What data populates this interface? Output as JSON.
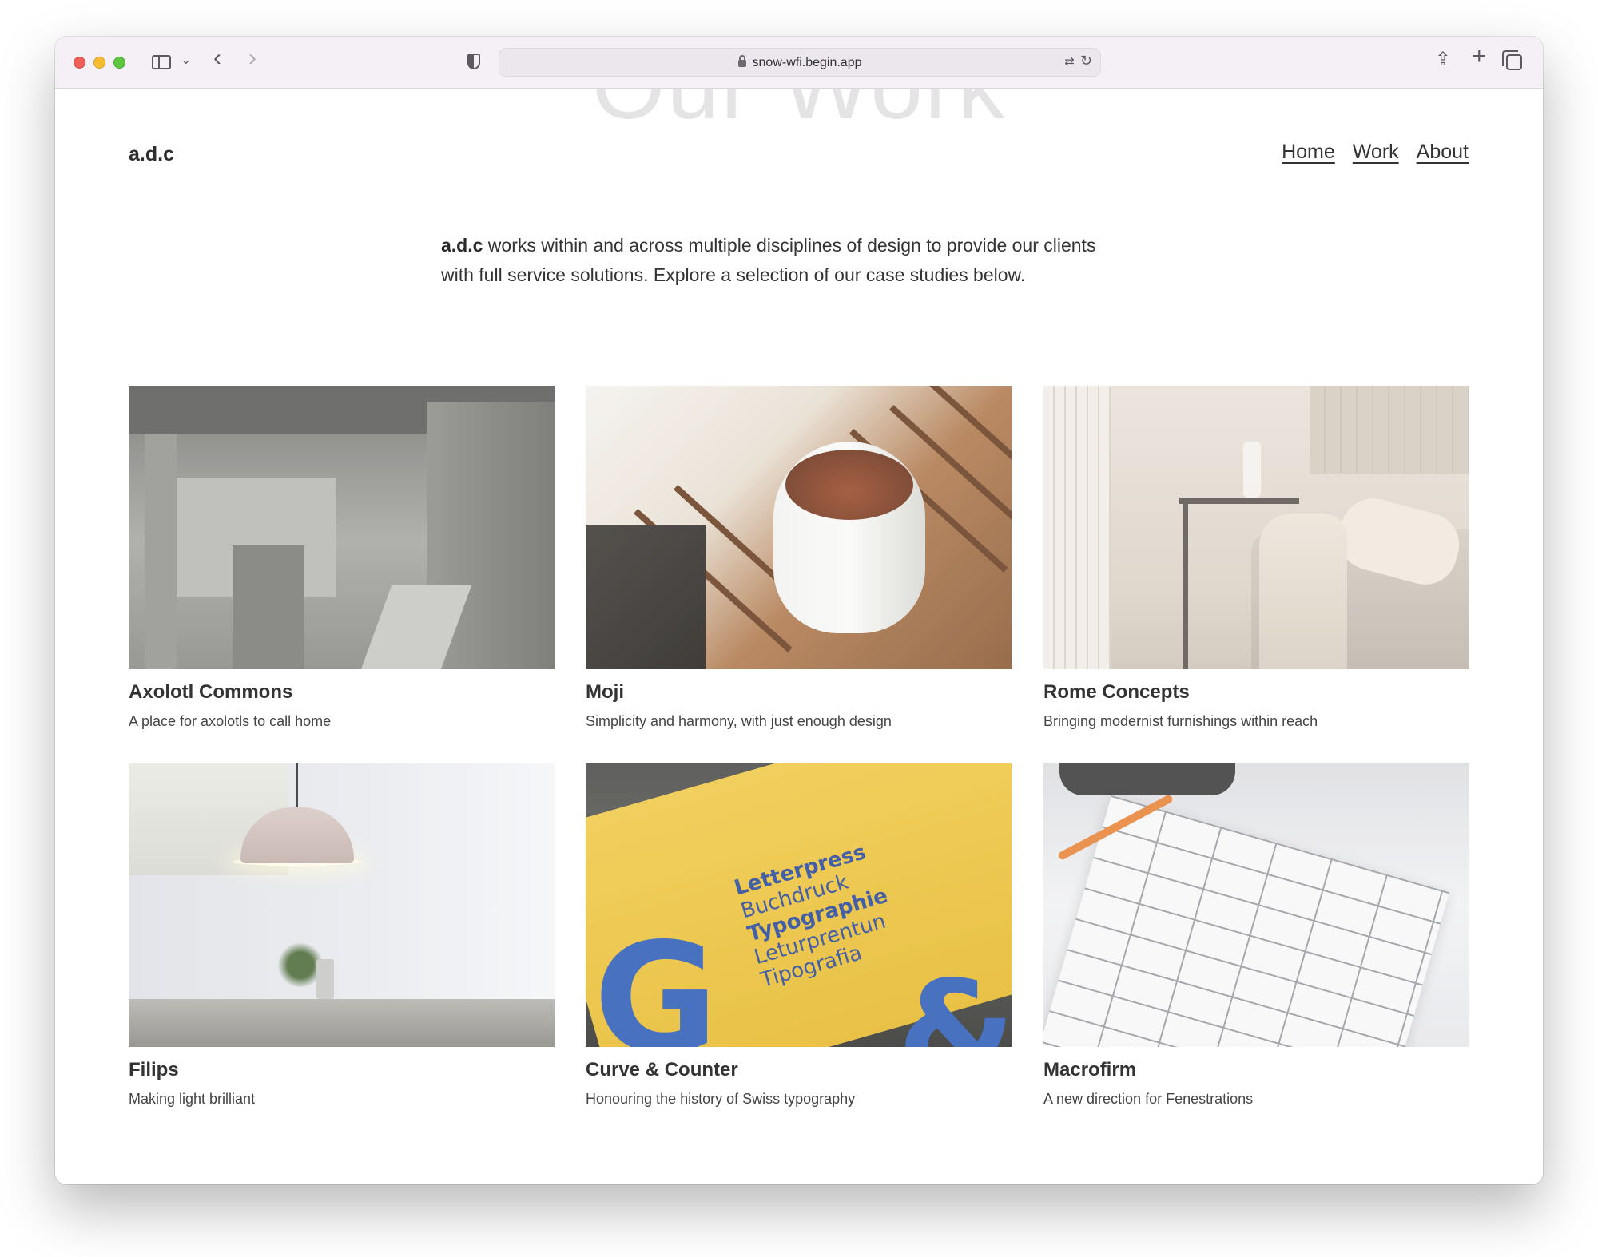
{
  "browser": {
    "url": "snow-wfi.begin.app",
    "icons": [
      "close-icon",
      "minimize-icon",
      "zoom-icon",
      "sidebar-icon",
      "chevron-down-icon",
      "back-icon",
      "forward-icon",
      "shield-icon",
      "lock-icon",
      "translate-icon",
      "reload-icon",
      "share-icon",
      "new-tab-icon",
      "tabs-overview-icon"
    ]
  },
  "site": {
    "ghost_heading": "Our Work",
    "logo": "a.d.c",
    "nav": [
      "Home",
      "Work",
      "About"
    ],
    "intro_brand": "a.d.c",
    "intro_text_1": " works within and across multiple disciplines of design to provide our clients",
    "intro_text_2": "with full service solutions. Explore a selection of our case studies below."
  },
  "projects": [
    {
      "title": "Axolotl Commons",
      "subtitle": "A place for axolotls to call home"
    },
    {
      "title": "Moji",
      "subtitle": "Simplicity and harmony, with just enough design"
    },
    {
      "title": "Rome Concepts",
      "subtitle": "Bringing modernist furnishings within reach"
    },
    {
      "title": "Filips",
      "subtitle": "Making light brilliant"
    },
    {
      "title": "Curve & Counter",
      "subtitle": "Honouring the history of Swiss typography"
    },
    {
      "title": "Macrofirm",
      "subtitle": "A new direction for Fenestrations"
    }
  ],
  "thumb_text": {
    "curve_g": "G",
    "curve_amp": "&",
    "curve_words": [
      "Letterpress",
      "Buchdruck",
      "Typographie",
      "Leturprentun",
      "Tipografia"
    ]
  }
}
